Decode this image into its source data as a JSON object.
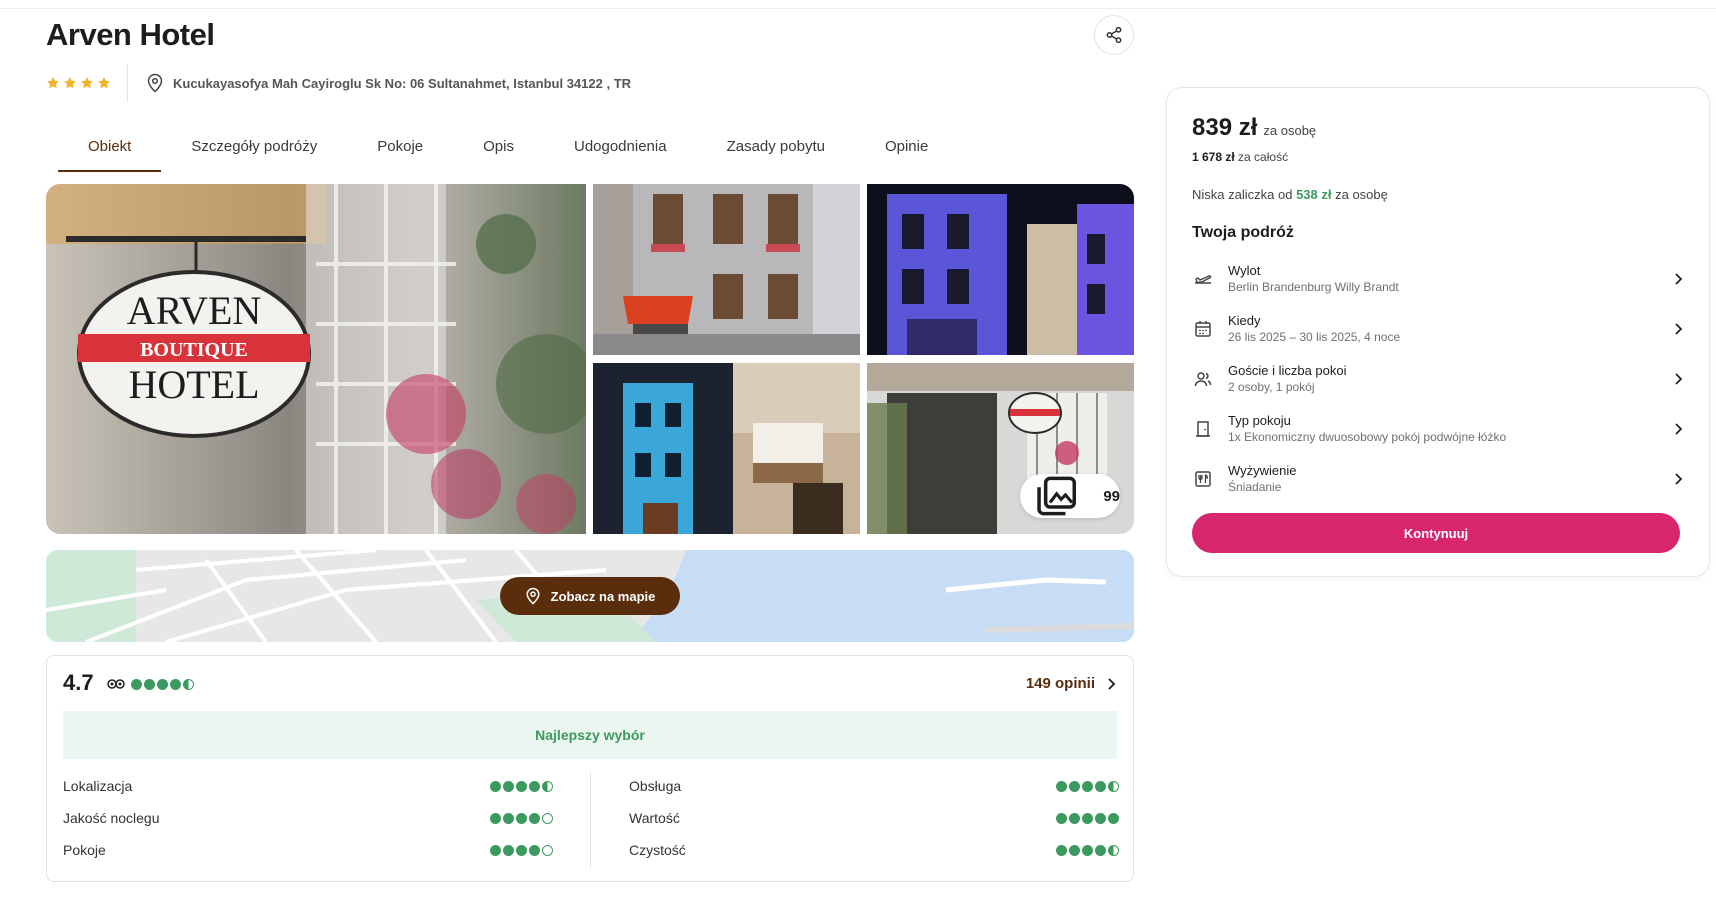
{
  "hotel": {
    "name": "Arven Hotel",
    "star_count": 4,
    "address": "Kucukayasofya Mah Cayiroglu Sk No: 06 Sultanahmet, Istanbul 34122 , TR"
  },
  "tabs": [
    {
      "label": "Obiekt",
      "active": true
    },
    {
      "label": "Szczegóły podróży",
      "active": false
    },
    {
      "label": "Pokoje",
      "active": false
    },
    {
      "label": "Opis",
      "active": false
    },
    {
      "label": "Udogodnienia",
      "active": false
    },
    {
      "label": "Zasady pobytu",
      "active": false
    },
    {
      "label": "Opinie",
      "active": false
    }
  ],
  "gallery": {
    "photo_count": "99",
    "sign_text": {
      "line1": "ARVEN",
      "line2": "BOUTIQUE",
      "line3": "HOTEL"
    }
  },
  "map": {
    "button_label": "Zobacz na mapie"
  },
  "reviews": {
    "score": "4.7",
    "overall_dots": 4.5,
    "count_label": "149 opinii",
    "badge": "Najlepszy wybór",
    "left": [
      {
        "label": "Lokalizacja",
        "rating": 4.5
      },
      {
        "label": "Jakość noclegu",
        "rating": 4
      },
      {
        "label": "Pokoje",
        "rating": 4
      }
    ],
    "right": [
      {
        "label": "Obsługa",
        "rating": 4.5
      },
      {
        "label": "Wartość",
        "rating": 5
      },
      {
        "label": "Czystość",
        "rating": 4.5
      }
    ]
  },
  "booking": {
    "price": "839 zł",
    "price_unit": "za osobę",
    "total_amount": "1 678 zł",
    "total_unit": "za całość",
    "deposit_prefix": "Niska zaliczka od",
    "deposit_amount": "538 zł",
    "deposit_suffix": "za osobę",
    "trip_title": "Twoja podróż",
    "trip_items": [
      {
        "icon": "plane-departure-icon",
        "label": "Wylot",
        "value": "Berlin Brandenburg Willy Brandt"
      },
      {
        "icon": "calendar-icon",
        "label": "Kiedy",
        "value": "26 lis 2025 – 30 lis 2025, 4 noce"
      },
      {
        "icon": "guests-icon",
        "label": "Goście i liczba pokoi",
        "value": "2 osoby, 1 pokój"
      },
      {
        "icon": "door-icon",
        "label": "Typ pokoju",
        "value": "1x Ekonomiczny dwuosobowy pokój podwójne łóżko"
      },
      {
        "icon": "cutlery-icon",
        "label": "Wyżywienie",
        "value": "Śniadanie"
      }
    ],
    "cta_label": "Kontynuuj"
  },
  "colors": {
    "brand_brown": "#5a2d0c",
    "cta_pink": "#d7266d",
    "rating_green": "#3c9a5f",
    "star_gold": "#f0b429"
  }
}
